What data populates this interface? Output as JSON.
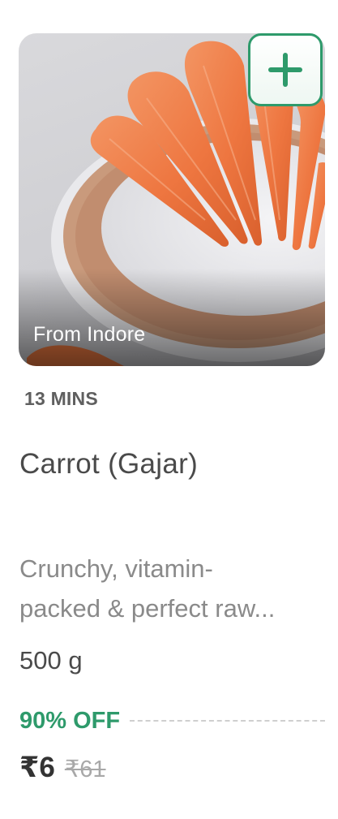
{
  "product": {
    "origin_label": "From Indore",
    "eta": "13 MINS",
    "name": "Carrot (Gajar)",
    "description_lines": [
      "Crunchy, vitamin-",
      "packed & perfect raw..."
    ],
    "quantity": "500 g",
    "discount": "90% OFF",
    "price": "₹6",
    "mrp": "₹61",
    "image_subject": "carrots on a plate"
  },
  "actions": {
    "add_icon": "plus-icon"
  },
  "colors": {
    "accent": "#2e9a6b",
    "text_primary": "#4a4a4a",
    "text_secondary": "#8a8a8a",
    "carrot": "#f07a45"
  }
}
